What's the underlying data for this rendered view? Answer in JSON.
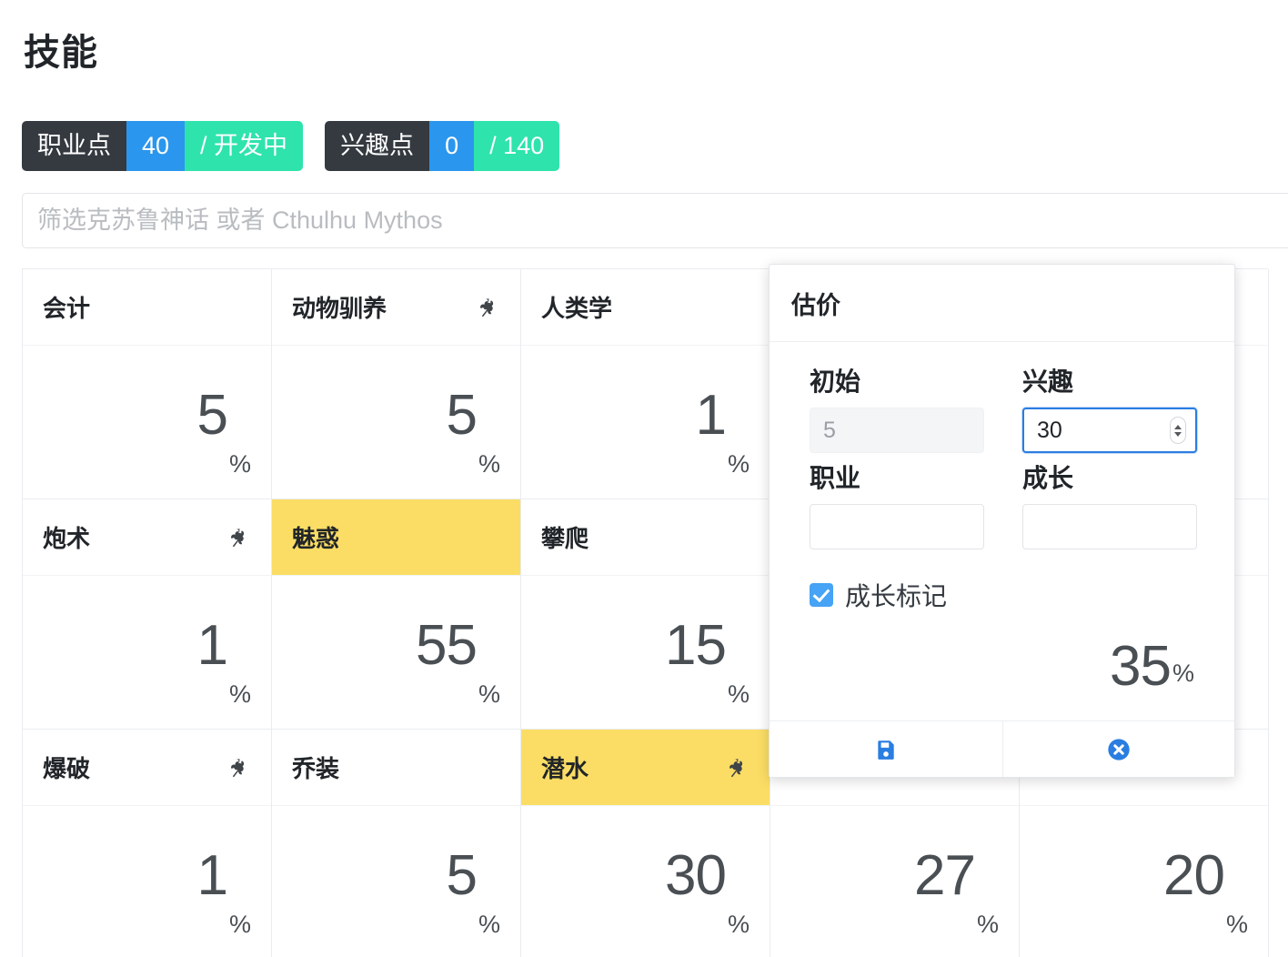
{
  "header": {
    "title": "技能"
  },
  "badges": [
    {
      "name": "occupation-points",
      "label": "职业点",
      "value": "40",
      "total": "/ 开发中"
    },
    {
      "name": "interest-points",
      "label": "兴趣点",
      "value": "0",
      "total": "/ 140"
    }
  ],
  "filter": {
    "placeholder": "筛选克苏鲁神话 或者 Cthulhu Mythos",
    "value": ""
  },
  "skills": [
    {
      "name": "会计",
      "value": "5",
      "unit": "%",
      "highlighted": false,
      "growth": false
    },
    {
      "name": "动物驯养",
      "value": "5",
      "unit": "%",
      "highlighted": false,
      "growth": true
    },
    {
      "name": "人类学",
      "value": "1",
      "unit": "%",
      "highlighted": false,
      "growth": false
    },
    {
      "name": "估价",
      "value": "",
      "unit": "",
      "highlighted": false,
      "growth": false
    },
    {
      "name": "",
      "value": "",
      "unit": "",
      "highlighted": false,
      "growth": false
    },
    {
      "name": "炮术",
      "value": "1",
      "unit": "%",
      "highlighted": false,
      "growth": true
    },
    {
      "name": "魅惑",
      "value": "55",
      "unit": "%",
      "highlighted": true,
      "growth": false
    },
    {
      "name": "攀爬",
      "value": "15",
      "unit": "%",
      "highlighted": false,
      "growth": false
    },
    {
      "name": "",
      "value": "",
      "unit": "",
      "highlighted": false,
      "growth": false
    },
    {
      "name": "",
      "value": "",
      "unit": "",
      "highlighted": false,
      "growth": false
    },
    {
      "name": "爆破",
      "value": "1",
      "unit": "%",
      "highlighted": false,
      "growth": true
    },
    {
      "name": "乔装",
      "value": "5",
      "unit": "%",
      "highlighted": false,
      "growth": false
    },
    {
      "name": "潜水",
      "value": "30",
      "unit": "%",
      "highlighted": true,
      "growth": true
    },
    {
      "name": "",
      "value": "27",
      "unit": "%",
      "highlighted": false,
      "growth": false
    },
    {
      "name": "",
      "value": "20",
      "unit": "%",
      "highlighted": false,
      "growth": false
    }
  ],
  "modal": {
    "title": "估价",
    "fields": {
      "base_label": "初始",
      "base_value": "5",
      "interest_label": "兴趣",
      "interest_value": "30",
      "occupation_label": "职业",
      "occupation_value": "",
      "growth_label": "成长",
      "growth_value": ""
    },
    "checkbox_label": "成长标记",
    "checkbox_checked": true,
    "total_value": "35",
    "total_unit": "%",
    "save_icon": "save-floppy-icon",
    "cancel_icon": "cancel-circle-x-icon"
  },
  "colors": {
    "badge_label_bg": "#343a40",
    "badge_value_bg": "#2b96ed",
    "badge_total_bg": "#2fe3ad",
    "highlight": "#fbdd65",
    "accent_blue": "#2a7de1",
    "checkbox_blue": "#46a3f5"
  },
  "icons": {
    "leaf": "leaf-icon"
  }
}
